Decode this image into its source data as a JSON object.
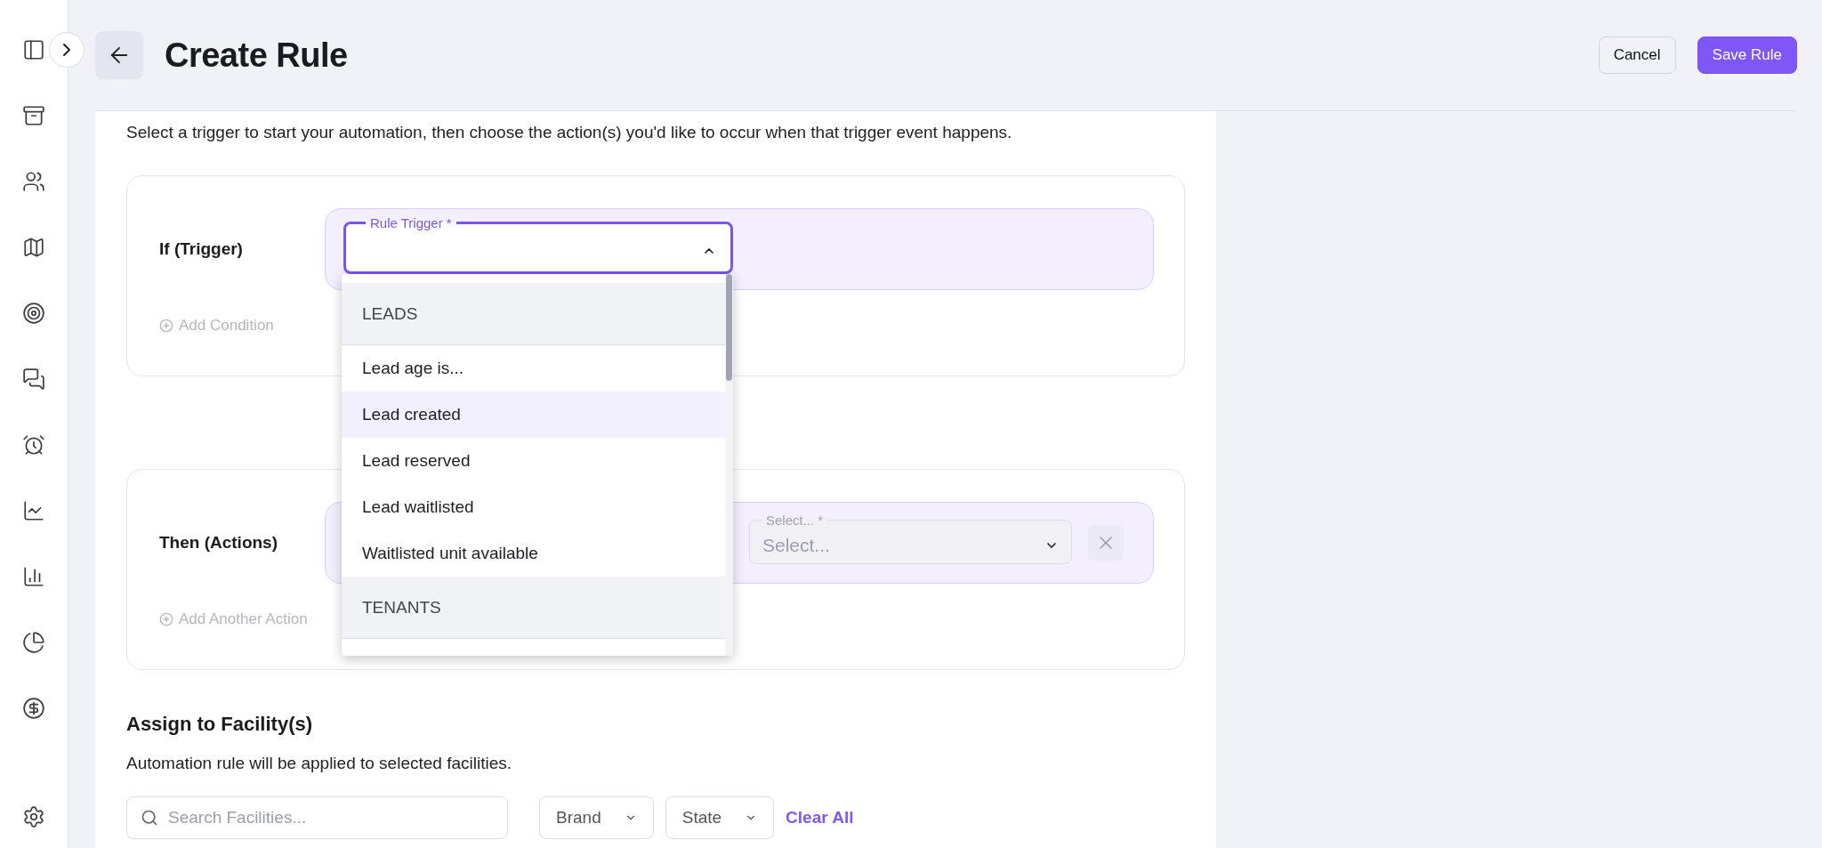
{
  "header": {
    "title": "Create Rule",
    "buttons": [
      {
        "label": "Cancel",
        "kind": "secondary"
      },
      {
        "label": "Save Rule",
        "kind": "primary"
      }
    ]
  },
  "intro": "Select a trigger to start your automation, then choose the action(s) you'd like to occur when that trigger event happens.",
  "trigger": {
    "label": "If (Trigger)",
    "field": {
      "label": "Rule Trigger *",
      "expanded": true
    },
    "add_link": "Add Condition"
  },
  "dropdown": {
    "items": [
      {
        "kind": "group",
        "label": "LEADS",
        "selected": false
      },
      {
        "kind": "option",
        "label": "Lead age is...",
        "selected": false
      },
      {
        "kind": "option",
        "label": "Lead created",
        "selected": true
      },
      {
        "kind": "option",
        "label": "Lead reserved",
        "selected": false
      },
      {
        "kind": "option",
        "label": "Lead waitlisted",
        "selected": false
      },
      {
        "kind": "option",
        "label": "Waitlisted unit available",
        "selected": false
      },
      {
        "kind": "group",
        "label": "TENANTS",
        "selected": false
      }
    ]
  },
  "actions": {
    "label": "Then (Actions)",
    "field": {
      "label": "Select... *",
      "placeholder": "Select..."
    },
    "add_link": "Add Another Action"
  },
  "facilities": {
    "title": "Assign to Facility(s)",
    "description": "Automation rule will be applied to selected facilities.",
    "search": {
      "placeholder": "Search Facilities..."
    },
    "filters": [
      "Brand",
      "State"
    ],
    "clear": "Clear All"
  }
}
